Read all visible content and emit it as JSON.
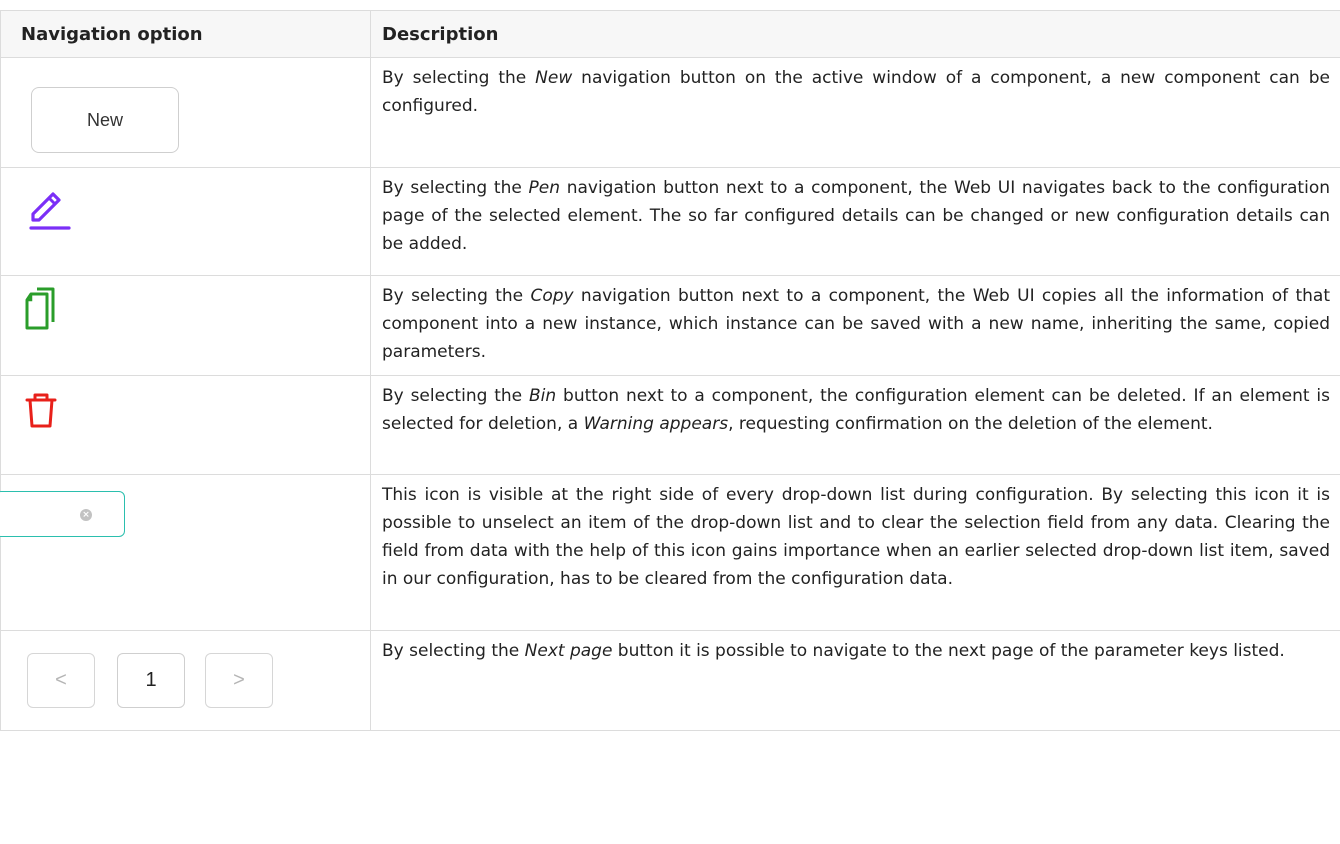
{
  "table": {
    "headers": {
      "option": "Navigation option",
      "description": "Description"
    },
    "rows": [
      {
        "option": {
          "type": "button",
          "label": "New"
        },
        "description": [
          "By selecting the ",
          {
            "em": "New"
          },
          " navigation button on the active window of a component, a new component can be configured."
        ]
      },
      {
        "option": {
          "type": "icon",
          "icon": "pen-icon",
          "color": "#7b2ff7"
        },
        "description": [
          "By selecting the ",
          {
            "em": "Pen"
          },
          " navigation button next to a component, the Web UI navigates back to the configuration page of the selected element. The so far configured details can be changed or new configuration details can be added."
        ]
      },
      {
        "option": {
          "type": "icon",
          "icon": "copy-icon",
          "color": "#2a9d2a"
        },
        "description": [
          "By selecting the ",
          {
            "em": "Copy"
          },
          " navigation button next to a component, the Web UI copies all the information of that component into a new instance, which instance can be saved with a new name, inheriting the same, copied parameters."
        ]
      },
      {
        "option": {
          "type": "icon",
          "icon": "bin-icon",
          "color": "#e8201a"
        },
        "description": [
          "By selecting the ",
          {
            "em": "Bin"
          },
          " button next to a component, the configuration element can be deleted. If an element is selected for deletion, a ",
          {
            "em": "Warning appears"
          },
          ", requesting confirmation on the deletion of the element."
        ]
      },
      {
        "option": {
          "type": "clear-field",
          "icon": "clear-x-icon",
          "color": "#2bbfae"
        },
        "description": [
          "This icon is visible at the right side of every drop-down list during configuration. By selecting this icon it is possible to unselect an item of the drop-down list and to clear the selection field from any data. Clearing the field from data with the help of this icon gains importance when an earlier selected drop-down list item, saved in our configuration, has to be cleared from the configuration data."
        ]
      },
      {
        "option": {
          "type": "pager",
          "prev": "<",
          "page": "1",
          "next": ">"
        },
        "description": [
          "By selecting the ",
          {
            "em": "Next page"
          },
          " button it is possible to navigate to the next page of the parameter keys listed."
        ]
      }
    ]
  }
}
